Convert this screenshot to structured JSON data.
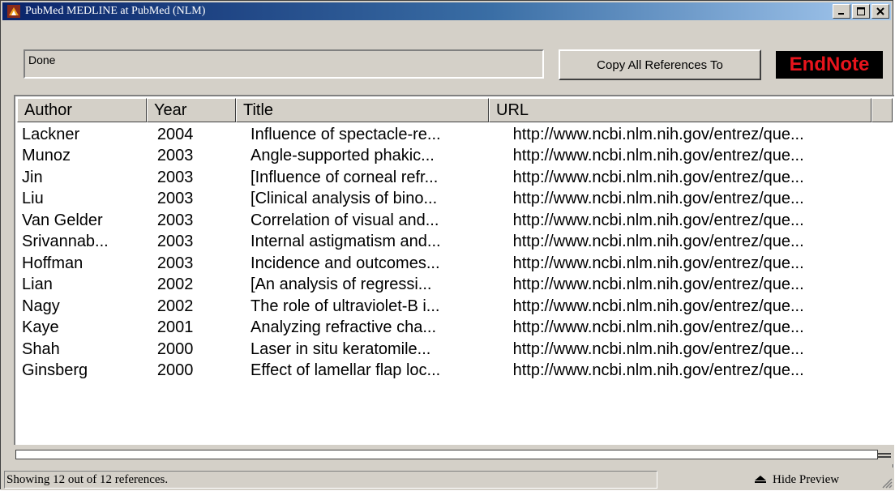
{
  "window": {
    "title": "PubMed MEDLINE at PubMed (NLM)"
  },
  "toolbar": {
    "status": "Done",
    "copy_button": "Copy All References To",
    "endnote_logo": "EndNote"
  },
  "table": {
    "columns": [
      "Author",
      "Year",
      "Title",
      "URL"
    ],
    "rows": [
      {
        "author": "Lackner",
        "year": "2004",
        "title": "Influence of spectacle-re...",
        "url": "http://www.ncbi.nlm.nih.gov/entrez/que..."
      },
      {
        "author": "Munoz",
        "year": "2003",
        "title": "Angle-supported phakic...",
        "url": "http://www.ncbi.nlm.nih.gov/entrez/que..."
      },
      {
        "author": "Jin",
        "year": "2003",
        "title": "[Influence of corneal refr...",
        "url": "http://www.ncbi.nlm.nih.gov/entrez/que..."
      },
      {
        "author": "Liu",
        "year": "2003",
        "title": "[Clinical analysis of bino...",
        "url": "http://www.ncbi.nlm.nih.gov/entrez/que..."
      },
      {
        "author": "Van Gelder",
        "year": "2003",
        "title": "Correlation of visual and...",
        "url": "http://www.ncbi.nlm.nih.gov/entrez/que..."
      },
      {
        "author": "Srivannab...",
        "year": "2003",
        "title": "Internal astigmatism and...",
        "url": "http://www.ncbi.nlm.nih.gov/entrez/que..."
      },
      {
        "author": "Hoffman",
        "year": "2003",
        "title": "Incidence and outcomes...",
        "url": "http://www.ncbi.nlm.nih.gov/entrez/que..."
      },
      {
        "author": "Lian",
        "year": "2002",
        "title": "[An analysis of regressi...",
        "url": "http://www.ncbi.nlm.nih.gov/entrez/que..."
      },
      {
        "author": "Nagy",
        "year": "2002",
        "title": "The role of ultraviolet-B i...",
        "url": "http://www.ncbi.nlm.nih.gov/entrez/que..."
      },
      {
        "author": "Kaye",
        "year": "2001",
        "title": "Analyzing refractive cha...",
        "url": "http://www.ncbi.nlm.nih.gov/entrez/que..."
      },
      {
        "author": "Shah",
        "year": "2000",
        "title": "Laser in situ keratomile...",
        "url": "http://www.ncbi.nlm.nih.gov/entrez/que..."
      },
      {
        "author": "Ginsberg",
        "year": "2000",
        "title": "Effect of lamellar flap loc...",
        "url": "http://www.ncbi.nlm.nih.gov/entrez/que..."
      }
    ]
  },
  "statusbar": {
    "text": "Showing 12 out of 12 references.",
    "hide_preview": "Hide Preview"
  },
  "colors": {
    "titlebar_start": "#0a246a",
    "titlebar_end": "#a6caf0",
    "endnote_red": "#e8141c"
  }
}
